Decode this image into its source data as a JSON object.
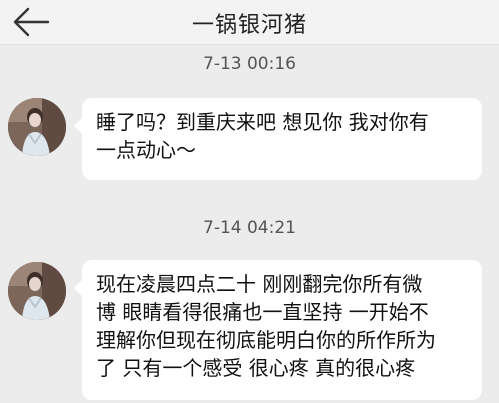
{
  "header": {
    "back_icon": "back-arrow-icon",
    "title": "一锅银河猪"
  },
  "messages": [
    {
      "timestamp": "7-13 00:16",
      "avatar_icon": "user-avatar",
      "text": "睡了吗？到重庆来吧 想见你 我对你有\n一点动心～"
    },
    {
      "timestamp": "7-14 04:21",
      "avatar_icon": "user-avatar",
      "text": "现在凌晨四点二十 刚刚翻完你所有微\n博 眼睛看得很痛也一直坚持 一开始不\n理解你但现在彻底能明白你的所作所为\n了 只有一个感受 很心疼 真的很心疼"
    }
  ],
  "colors": {
    "background": "#ececec",
    "bubble": "#ffffff",
    "header": "#f3f3f3"
  }
}
